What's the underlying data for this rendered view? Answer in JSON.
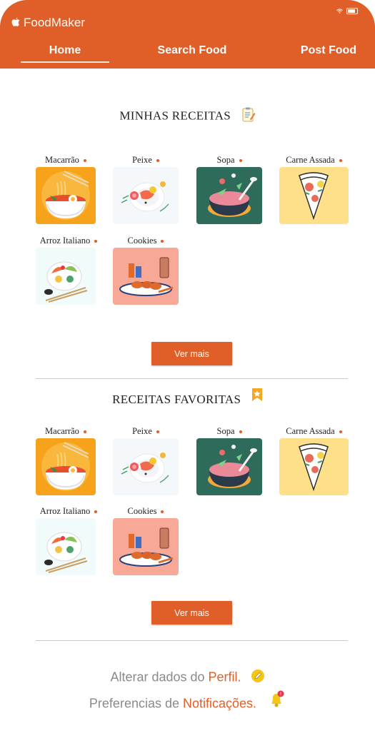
{
  "app": {
    "name": "FoodMaker"
  },
  "nav": {
    "tabs": [
      {
        "label": "Home",
        "active": true
      },
      {
        "label": "Search Food"
      },
      {
        "label": "Post Food"
      }
    ]
  },
  "my_recipes": {
    "title": "MINHAS RECEITAS",
    "items": [
      {
        "label": "Macarrão",
        "icon": "ramen-bowl-icon"
      },
      {
        "label": "Peixe",
        "icon": "fish-plate-icon"
      },
      {
        "label": "Sopa",
        "icon": "soup-pot-icon"
      },
      {
        "label": "Carne Assada",
        "icon": "pizza-slice-icon"
      },
      {
        "label": "Arroz Italiano",
        "icon": "rice-bowl-icon"
      },
      {
        "label": "Cookies",
        "icon": "cookies-plate-icon"
      }
    ],
    "more_label": "Ver mais"
  },
  "favorite_recipes": {
    "title": "RECEITAS FAVORITAS",
    "items": [
      {
        "label": "Macarrão",
        "icon": "ramen-bowl-icon"
      },
      {
        "label": "Peixe",
        "icon": "fish-plate-icon"
      },
      {
        "label": "Sopa",
        "icon": "soup-pot-icon"
      },
      {
        "label": "Carne Assada",
        "icon": "pizza-slice-icon"
      },
      {
        "label": "Arroz Italiano",
        "icon": "rice-bowl-icon"
      },
      {
        "label": "Cookies",
        "icon": "cookies-plate-icon"
      }
    ],
    "more_label": "Ver mais"
  },
  "profile_link": {
    "prefix": "Alterar dados do ",
    "link": "Perfil."
  },
  "notifications_link": {
    "prefix": "Preferencias de ",
    "link": "Notificações."
  },
  "colors": {
    "accent": "#e05e28",
    "divider": "#c9c9c9"
  }
}
